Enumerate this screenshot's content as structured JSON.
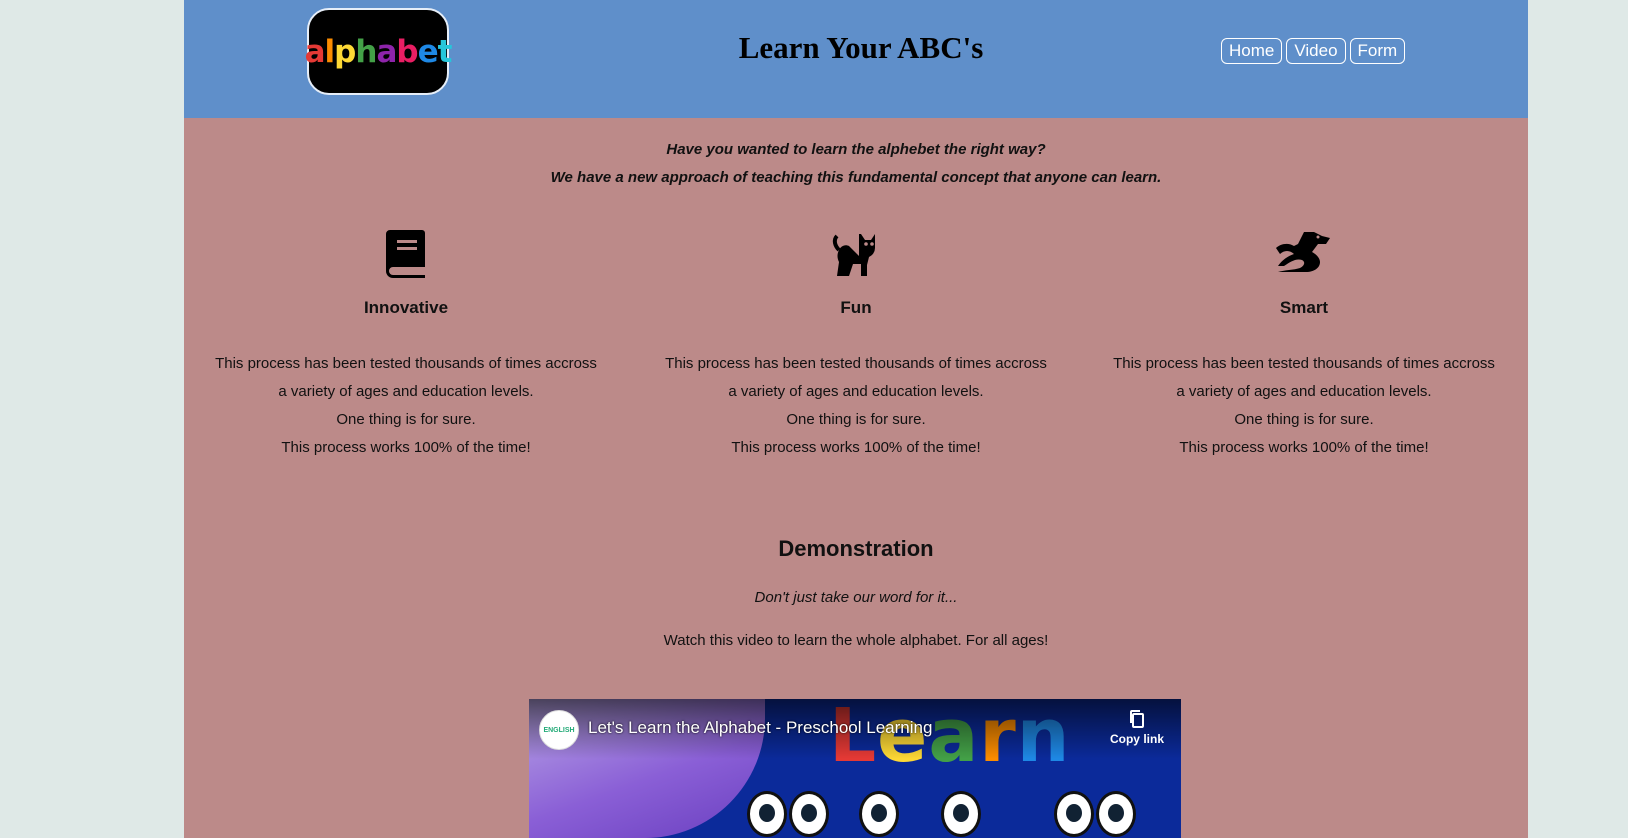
{
  "header": {
    "logo_text": "alphabet",
    "logo_letters": [
      {
        "ch": "a",
        "color": "#e53935"
      },
      {
        "ch": "l",
        "color": "#fb8c00"
      },
      {
        "ch": "p",
        "color": "#fdd835"
      },
      {
        "ch": "h",
        "color": "#43a047"
      },
      {
        "ch": "a",
        "color": "#8e24aa"
      },
      {
        "ch": "b",
        "color": "#e91e63"
      },
      {
        "ch": "e",
        "color": "#1e88e5"
      },
      {
        "ch": "t",
        "color": "#26c6da"
      }
    ],
    "title": "Learn Your ABC's",
    "nav": [
      "Home",
      "Video",
      "Form"
    ]
  },
  "intro": {
    "line1": "Have you wanted to learn the alphebet the right way?",
    "line2": "We have a new approach of teaching this fundamental concept that anyone can learn."
  },
  "features": [
    {
      "icon": "book-icon",
      "title": "Innovative",
      "lines": [
        "This process has been tested thousands of times accross",
        "a variety of ages and education levels.",
        "One thing is for sure.",
        "This process works 100% of the time!"
      ]
    },
    {
      "icon": "cat-icon",
      "title": "Fun",
      "lines": [
        "This process has been tested thousands of times accross",
        "a variety of ages and education levels.",
        "One thing is for sure.",
        "This process works 100% of the time!"
      ]
    },
    {
      "icon": "dragon-icon",
      "title": "Smart",
      "lines": [
        "This process has been tested thousands of times accross",
        "a variety of ages and education levels.",
        "One thing is for sure.",
        "This process works 100% of the time!"
      ]
    }
  ],
  "demo": {
    "title": "Demonstration",
    "subtitle": "Don't just take our word for it...",
    "text": "Watch this video to learn the whole alphabet. For all ages!"
  },
  "video": {
    "title": "Let's Learn the Alphabet - Preschool Learning",
    "copy_link": "Copy link",
    "channel": "ENGLISH",
    "thumb_word": "Learn",
    "thumb_colors": [
      "#e53935",
      "#fdd835",
      "#43a047",
      "#fb8c00",
      "#1e88e5"
    ]
  },
  "colors": {
    "page_bg": "#dfe9e7",
    "header_bg": "#5f8fca",
    "content_bg": "#bc8a89"
  }
}
